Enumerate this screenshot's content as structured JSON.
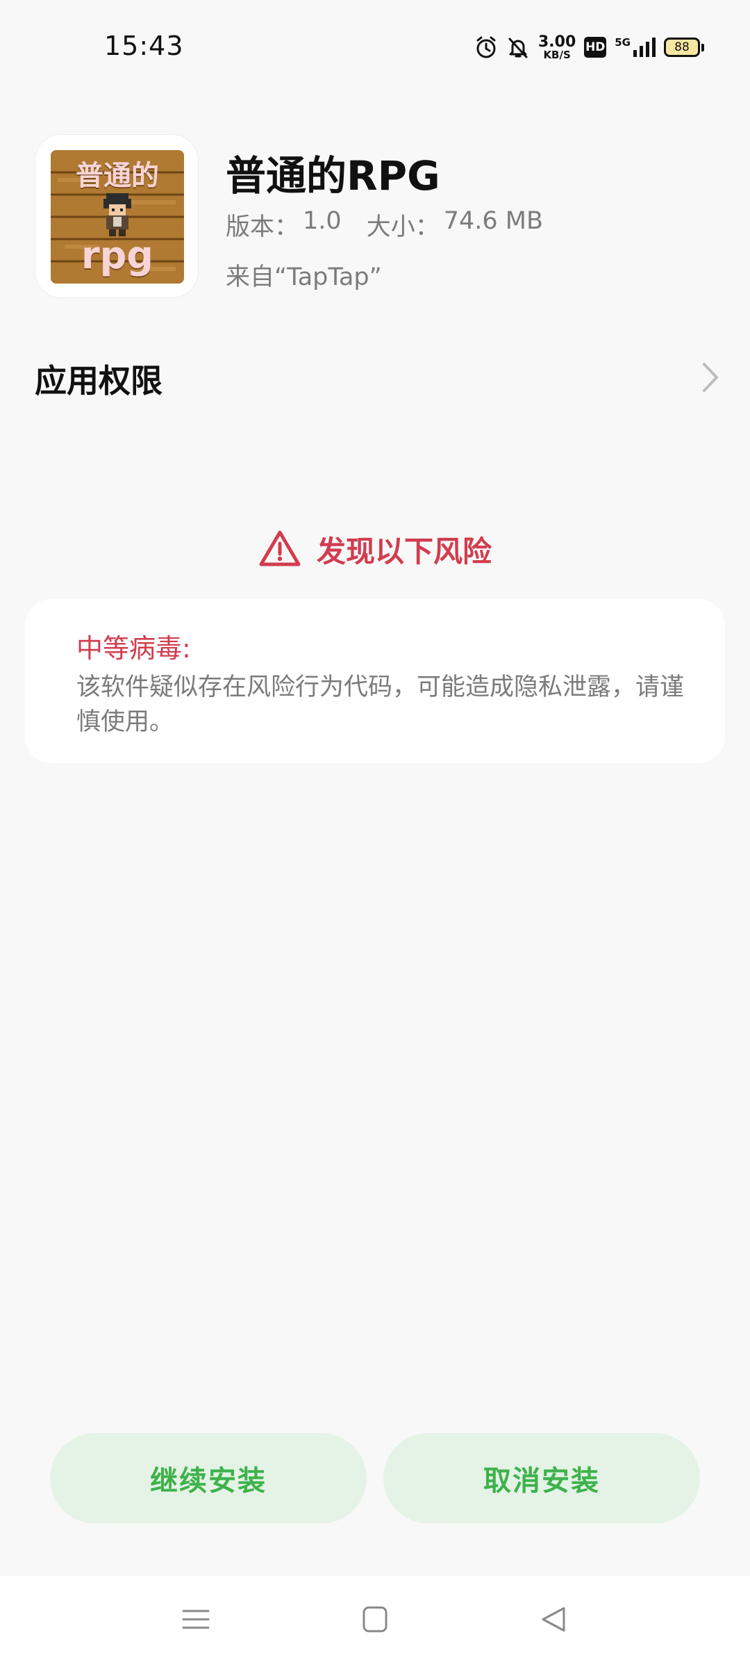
{
  "status_bar": {
    "time": "15:43",
    "speed_value": "3.00",
    "speed_unit": "KB/S",
    "hd_label": "HD",
    "network_label": "5G",
    "battery_level": "88",
    "icons": [
      "alarm-icon",
      "bell-muted-icon",
      "signal-icon",
      "battery-icon"
    ]
  },
  "app": {
    "icon_caption_top": "普通的",
    "icon_caption_bottom": "rpg",
    "name": "普通的RPG",
    "version_label": "版本：",
    "version_value": "1.0",
    "size_label": "大小：",
    "size_value": "74.6 MB",
    "source": "来自“TapTap”"
  },
  "permissions": {
    "label": "应用权限",
    "icon": "chevron-right-icon"
  },
  "risk": {
    "title": "发现以下风险",
    "icon": "warning-triangle-icon",
    "level": "中等病毒:",
    "description": "该软件疑似存在风险行为代码，可能造成隐私泄露，请谨慎使用。"
  },
  "actions": {
    "continue_label": "继续安装",
    "cancel_label": "取消安装"
  },
  "nav": {
    "icons": [
      "menu-icon",
      "home-icon",
      "back-icon"
    ]
  },
  "colors": {
    "danger": "#d23c4e",
    "accent_green": "#3db24b",
    "button_bg": "#e4f3e5",
    "background": "#f8f8f8"
  }
}
